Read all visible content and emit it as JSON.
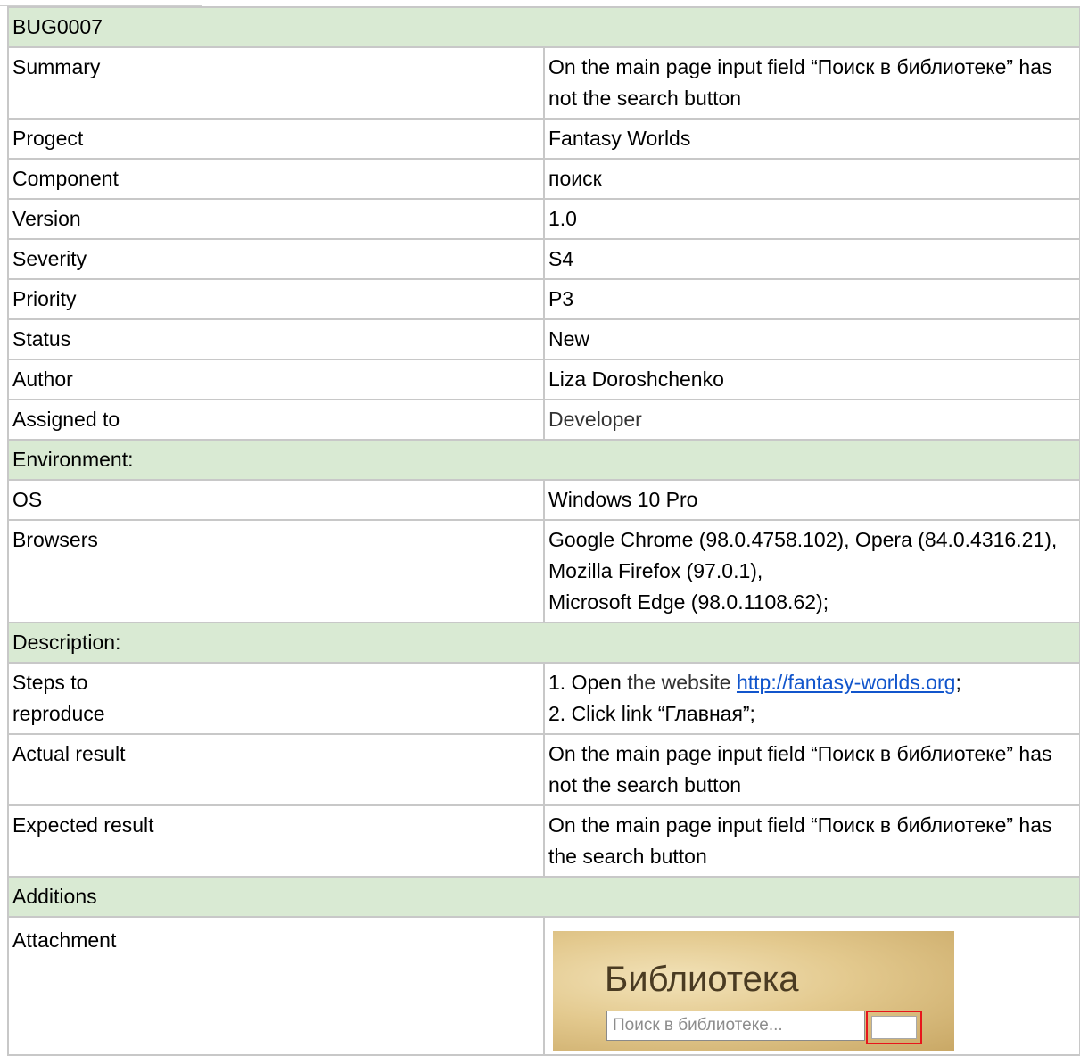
{
  "bug_id": "BUG0007",
  "fields": [
    {
      "label": "Summary",
      "value": "On the main page input field “Поиск в библиотеке” has not the search button"
    },
    {
      "label": "Progect",
      "value": "Fantasy Worlds"
    },
    {
      "label": "Component",
      "value": "поиск"
    },
    {
      "label": "Version",
      "value": "1.0"
    },
    {
      "label": "Severity",
      "value": "S4"
    },
    {
      "label": "Priority",
      "value": "P3"
    },
    {
      "label": "Status",
      "value": "New"
    },
    {
      "label": "Author",
      "value": "Liza Doroshchenko"
    },
    {
      "label": "Assigned to",
      "value": "Developer"
    }
  ],
  "environment": {
    "heading": "Environment:",
    "os_label": "OS",
    "os_value": "Windows 10 Pro",
    "browsers_label": "Browsers",
    "browsers_line1": "Google Chrome (98.0.4758.102), Opera (84.0.4316.21), Mozilla Firefox (97.0.1),",
    "browsers_line2": "Microsoft Edge (98.0.1108.62);"
  },
  "description": {
    "heading": "Description:",
    "steps_label_line1": "Steps to",
    "steps_label_line2": "reproduce",
    "step1_prefix": "1. Open",
    "step1_middle": " the website ",
    "step1_link": "http://fantasy-worlds.org",
    "step1_suffix": ";",
    "step2": "2. Click link “Главная”;",
    "actual_label": "Actual result",
    "actual_value": "On the main page input field “Поиск в библиотеке” has not the search button",
    "expected_label": "Expected result",
    "expected_value": "On the main page input field “Поиск в библиотеке” has the search button"
  },
  "additions": {
    "heading": "Additions",
    "attachment_label": "Attachment",
    "screenshot": {
      "title": "Библиотека",
      "input_placeholder": "Поиск в библиотеке...",
      "highlight_color": "#e8151b"
    }
  },
  "colors": {
    "section_bg": "#d9ead3",
    "border": "#c8c8c8",
    "link": "#1155cc"
  }
}
